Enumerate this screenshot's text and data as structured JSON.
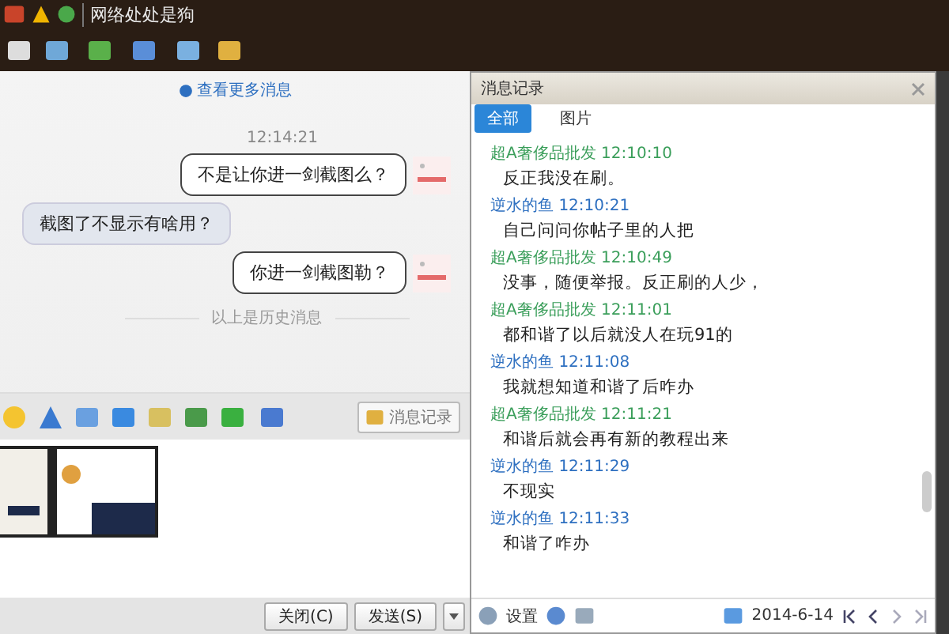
{
  "window": {
    "title": "网络处处是狗"
  },
  "chat": {
    "more_link": "查看更多消息",
    "messages": [
      {
        "kind": "time",
        "text": "12:14:21"
      },
      {
        "kind": "sent",
        "text": "不是让你进一剑截图么？"
      },
      {
        "kind": "received",
        "text": "截图了不显示有啥用？"
      },
      {
        "kind": "sent",
        "text": "你进一剑截图勒？"
      },
      {
        "kind": "divider",
        "text": "以上是历史消息"
      }
    ]
  },
  "input_toolbar": {
    "history_button": "消息记录"
  },
  "buttons": {
    "close": "关闭(C)",
    "send": "发送(S)"
  },
  "history": {
    "title": "消息记录",
    "tabs": [
      {
        "label": "全部",
        "selected": true
      },
      {
        "label": "图片",
        "selected": false
      }
    ],
    "entries": [
      {
        "sender": "超A奢侈品批发",
        "time": "12:10:10",
        "color": "#3a9e5a",
        "text": "反正我没在刷。"
      },
      {
        "sender": "逆水的鱼",
        "time": "12:10:21",
        "color": "#2d6fc0",
        "text": "自己问问你帖子里的人把"
      },
      {
        "sender": "超A奢侈品批发",
        "time": "12:10:49",
        "color": "#3a9e5a",
        "text": "没事，随便举报。反正刷的人少，"
      },
      {
        "sender": "超A奢侈品批发",
        "time": "12:11:01",
        "color": "#3a9e5a",
        "text": "都和谐了以后就没人在玩91的"
      },
      {
        "sender": "逆水的鱼",
        "time": "12:11:08",
        "color": "#2d6fc0",
        "text": "我就想知道和谐了后咋办"
      },
      {
        "sender": "超A奢侈品批发",
        "time": "12:11:21",
        "color": "#3a9e5a",
        "text": "和谐后就会再有新的教程出来"
      },
      {
        "sender": "逆水的鱼",
        "time": "12:11:29",
        "color": "#2d6fc0",
        "text": "不现实"
      },
      {
        "sender": "逆水的鱼",
        "time": "12:11:33",
        "color": "#2d6fc0",
        "text": "和谐了咋办"
      }
    ],
    "footer": {
      "settings": "设置",
      "date": "2014-6-14"
    }
  }
}
